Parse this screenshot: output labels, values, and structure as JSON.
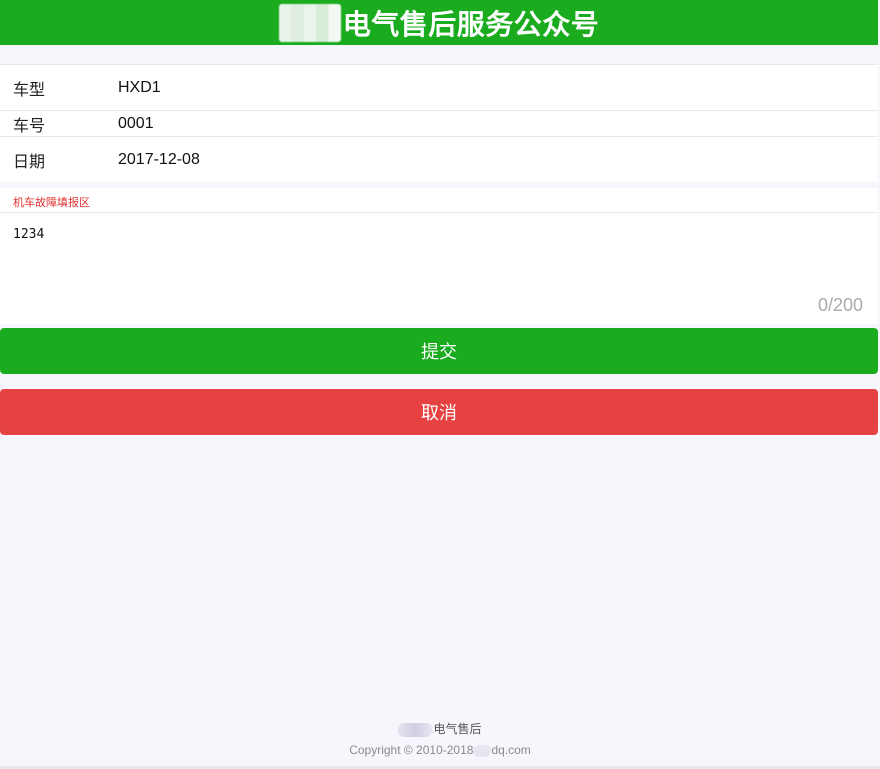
{
  "header": {
    "title": "电气售后服务公众号",
    "bg_color": "#1aac1e"
  },
  "info": {
    "rows": [
      {
        "label": "车型",
        "value": "HXD1"
      },
      {
        "label": "车号",
        "value": "0001"
      },
      {
        "label": "日期",
        "value": "2017-12-08"
      }
    ]
  },
  "report": {
    "section_label": "机车故障填报区",
    "text": "1234",
    "counter": "0/200"
  },
  "buttons": {
    "submit_label": "提交",
    "submit_color": "#1aac1e",
    "cancel_label": "取消",
    "cancel_color": "#e64242"
  },
  "footer": {
    "brand": "电气售后",
    "copyright_prefix": "Copyright © 2010-2018",
    "copyright_suffix": "dq.com"
  }
}
